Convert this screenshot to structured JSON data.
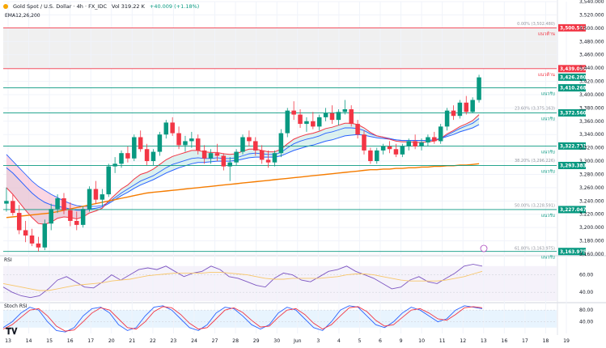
{
  "header": {
    "symbol": "Gold Spot / U.S. Dollar · 4h · FX_IDC",
    "volume": "Vol 319.22 K",
    "change": "+40.009 (+1.18%)",
    "ema_label": "EMA12,26,200"
  },
  "indicators": {
    "rsi_label": "RSI",
    "stoch_label": "Stoch RSI"
  },
  "colors": {
    "up": "#089981",
    "down": "#f23645",
    "ema12": "#f23645",
    "ema26": "#2962ff",
    "ema200": "#f57c00",
    "resistance": "#f23645",
    "support": "#089981"
  },
  "chart_data": [
    {
      "type": "candlestick",
      "title": "Gold Spot / U.S. Dollar · 4h · FX_IDC",
      "ylim": [
        3160,
        3540
      ],
      "y_ticks": [
        3160,
        3180,
        3200,
        3220,
        3240,
        3260,
        3280,
        3300,
        3320,
        3340,
        3360,
        3380,
        3400,
        3420,
        3440,
        3460,
        3480,
        3500,
        3520,
        3540
      ],
      "x_ticks": [
        "13",
        "14",
        "15",
        "16",
        "17",
        "20",
        "21",
        "22",
        "23",
        "24",
        "27",
        "28",
        "29",
        "30",
        "Jun",
        "3",
        "4",
        "5",
        "6",
        "9",
        "10",
        "11",
        "12",
        "13",
        "16",
        "17",
        "18",
        "19"
      ],
      "last_price": 3426.28,
      "candles_ohlc": [
        [
          3236,
          3260,
          3224,
          3240
        ],
        [
          3240,
          3250,
          3218,
          3222
        ],
        [
          3222,
          3234,
          3190,
          3196
        ],
        [
          3196,
          3210,
          3178,
          3188
        ],
        [
          3188,
          3198,
          3172,
          3176
        ],
        [
          3176,
          3186,
          3164,
          3170
        ],
        [
          3170,
          3212,
          3166,
          3206
        ],
        [
          3206,
          3236,
          3196,
          3228
        ],
        [
          3228,
          3250,
          3222,
          3244
        ],
        [
          3244,
          3252,
          3220,
          3226
        ],
        [
          3226,
          3238,
          3202,
          3210
        ],
        [
          3210,
          3224,
          3196,
          3204
        ],
        [
          3204,
          3232,
          3200,
          3228
        ],
        [
          3228,
          3262,
          3224,
          3258
        ],
        [
          3258,
          3270,
          3236,
          3242
        ],
        [
          3242,
          3258,
          3232,
          3250
        ],
        [
          3250,
          3296,
          3246,
          3292
        ],
        [
          3292,
          3306,
          3282,
          3296
        ],
        [
          3296,
          3316,
          3290,
          3312
        ],
        [
          3312,
          3322,
          3298,
          3304
        ],
        [
          3304,
          3340,
          3300,
          3336
        ],
        [
          3336,
          3346,
          3314,
          3318
        ],
        [
          3318,
          3326,
          3294,
          3300
        ],
        [
          3300,
          3318,
          3294,
          3314
        ],
        [
          3314,
          3344,
          3308,
          3340
        ],
        [
          3340,
          3362,
          3334,
          3358
        ],
        [
          3358,
          3366,
          3338,
          3342
        ],
        [
          3342,
          3352,
          3318,
          3324
        ],
        [
          3324,
          3338,
          3314,
          3330
        ],
        [
          3330,
          3344,
          3320,
          3334
        ],
        [
          3334,
          3340,
          3310,
          3316
        ],
        [
          3316,
          3324,
          3296,
          3304
        ],
        [
          3304,
          3318,
          3296,
          3312
        ],
        [
          3312,
          3326,
          3300,
          3308
        ],
        [
          3308,
          3312,
          3286,
          3292
        ],
        [
          3292,
          3306,
          3270,
          3298
        ],
        [
          3298,
          3318,
          3294,
          3314
        ],
        [
          3314,
          3340,
          3310,
          3336
        ],
        [
          3336,
          3346,
          3322,
          3330
        ],
        [
          3330,
          3336,
          3308,
          3316
        ],
        [
          3316,
          3324,
          3296,
          3302
        ],
        [
          3302,
          3316,
          3290,
          3298
        ],
        [
          3298,
          3316,
          3292,
          3312
        ],
        [
          3312,
          3348,
          3306,
          3342
        ],
        [
          3342,
          3380,
          3336,
          3376
        ],
        [
          3376,
          3390,
          3362,
          3370
        ],
        [
          3370,
          3378,
          3350,
          3356
        ],
        [
          3356,
          3366,
          3344,
          3360
        ],
        [
          3360,
          3374,
          3348,
          3352
        ],
        [
          3352,
          3370,
          3346,
          3366
        ],
        [
          3366,
          3380,
          3360,
          3372
        ],
        [
          3372,
          3384,
          3356,
          3362
        ],
        [
          3362,
          3378,
          3354,
          3374
        ],
        [
          3374,
          3392,
          3370,
          3378
        ],
        [
          3378,
          3384,
          3352,
          3356
        ],
        [
          3356,
          3362,
          3334,
          3340
        ],
        [
          3340,
          3346,
          3310,
          3316
        ],
        [
          3316,
          3320,
          3296,
          3300
        ],
        [
          3300,
          3320,
          3296,
          3316
        ],
        [
          3316,
          3326,
          3310,
          3322
        ],
        [
          3322,
          3330,
          3312,
          3318
        ],
        [
          3318,
          3326,
          3306,
          3310
        ],
        [
          3310,
          3326,
          3306,
          3322
        ],
        [
          3322,
          3334,
          3316,
          3330
        ],
        [
          3330,
          3340,
          3318,
          3322
        ],
        [
          3322,
          3334,
          3316,
          3328
        ],
        [
          3328,
          3340,
          3322,
          3336
        ],
        [
          3336,
          3344,
          3326,
          3330
        ],
        [
          3330,
          3356,
          3326,
          3352
        ],
        [
          3352,
          3380,
          3346,
          3376
        ],
        [
          3376,
          3384,
          3362,
          3368
        ],
        [
          3368,
          3392,
          3364,
          3388
        ],
        [
          3388,
          3398,
          3370,
          3374
        ],
        [
          3374,
          3396,
          3372,
          3392
        ],
        [
          3392,
          3430,
          3388,
          3426
        ]
      ],
      "ema12_points": [
        3260,
        3250,
        3238,
        3226,
        3215,
        3206,
        3205,
        3208,
        3214,
        3216,
        3215,
        3213,
        3216,
        3222,
        3225,
        3229,
        3240,
        3249,
        3258,
        3264,
        3273,
        3280,
        3283,
        3288,
        3295,
        3302,
        3307,
        3310,
        3313,
        3316,
        3316,
        3314,
        3313,
        3313,
        3311,
        3310,
        3311,
        3315,
        3318,
        3318,
        3316,
        3314,
        3314,
        3318,
        3326,
        3333,
        3337,
        3340,
        3342,
        3345,
        3349,
        3351,
        3354,
        3357,
        3357,
        3355,
        3350,
        3343,
        3338,
        3336,
        3333,
        3330,
        3329,
        3329,
        3328,
        3328,
        3329,
        3330,
        3334,
        3341,
        3346,
        3352,
        3356,
        3361,
        3370
      ],
      "ema26_points": [
        3290,
        3282,
        3272,
        3262,
        3252,
        3244,
        3238,
        3234,
        3232,
        3230,
        3228,
        3226,
        3226,
        3228,
        3229,
        3231,
        3236,
        3242,
        3248,
        3253,
        3259,
        3264,
        3268,
        3272,
        3277,
        3282,
        3286,
        3290,
        3293,
        3296,
        3298,
        3298,
        3299,
        3300,
        3300,
        3300,
        3301,
        3303,
        3305,
        3306,
        3306,
        3306,
        3306,
        3308,
        3312,
        3316,
        3319,
        3322,
        3324,
        3327,
        3330,
        3332,
        3335,
        3338,
        3339,
        3340,
        3339,
        3337,
        3335,
        3334,
        3333,
        3332,
        3331,
        3331,
        3331,
        3331,
        3331,
        3332,
        3334,
        3337,
        3340,
        3344,
        3347,
        3350,
        3355
      ],
      "ema200_points": [
        3215,
        3216,
        3217,
        3218,
        3219,
        3220,
        3221,
        3222,
        3224,
        3226,
        3228,
        3230,
        3232,
        3234,
        3236,
        3238,
        3240,
        3242,
        3244,
        3246,
        3248,
        3250,
        3252,
        3253,
        3254,
        3255,
        3256,
        3257,
        3258,
        3259,
        3260,
        3261,
        3262,
        3263,
        3264,
        3265,
        3266,
        3267,
        3268,
        3269,
        3270,
        3271,
        3272,
        3273,
        3274,
        3275,
        3276,
        3277,
        3278,
        3279,
        3280,
        3281,
        3282,
        3283,
        3284,
        3285,
        3286,
        3287,
        3287,
        3288,
        3288,
        3289,
        3289,
        3290,
        3290,
        3291,
        3291,
        3292,
        3292,
        3293,
        3293,
        3294,
        3294,
        3295,
        3296
      ],
      "band_top": [
        3310,
        3300,
        3290,
        3280,
        3270,
        3262,
        3256,
        3250,
        3245,
        3240,
        3236,
        3233,
        3232,
        3232,
        3232,
        3233,
        3238,
        3245,
        3252,
        3258,
        3264,
        3270,
        3274,
        3278,
        3284,
        3290,
        3295,
        3298,
        3301,
        3304,
        3305,
        3304,
        3304,
        3305,
        3304,
        3304,
        3305,
        3308,
        3311,
        3312,
        3311,
        3310,
        3310,
        3313,
        3320,
        3326,
        3330,
        3333,
        3335,
        3338,
        3342,
        3344,
        3347,
        3350,
        3350,
        3349,
        3346,
        3341,
        3338,
        3336,
        3334,
        3332,
        3331,
        3331,
        3331,
        3331,
        3331,
        3332,
        3334,
        3339,
        3344,
        3349,
        3353,
        3357,
        3364
      ],
      "levels": [
        {
          "label": "แนวต้าน",
          "value": 3500.551,
          "value_text": "3,500.551",
          "type": "resistance",
          "fib": "0.00% (3,502.480)",
          "fib_value": 3502.48
        },
        {
          "label": "แนวต้าน",
          "value": 3439.099,
          "value_text": "3,439.099",
          "type": "resistance"
        },
        {
          "label": "แนวรับ",
          "value": 3410.268,
          "value_text": "3,410.268",
          "type": "support"
        },
        {
          "label": "แนวรับ",
          "value": 3372.56,
          "value_text": "3,372.560",
          "type": "support",
          "fib": "23.60% (3,375.163)",
          "fib_value": 3375.163
        },
        {
          "label": "แนวรับ",
          "value": 3322.731,
          "value_text": "3,322.731",
          "type": "support"
        },
        {
          "label": "แนวรับ",
          "value": 3293.383,
          "value_text": "3,293.383",
          "type": "support",
          "fib": "38.20% (3,296.226)",
          "fib_value": 3296.226
        },
        {
          "label": "แนวรับ",
          "value": 3227.047,
          "value_text": "3,227.047",
          "type": "support",
          "fib": "50.00% (3,228.591)",
          "fib_value": 3228.591
        },
        {
          "label": "แนวรับ",
          "value": 3163.975,
          "value_text": "3,163.975",
          "type": "support",
          "fib": "61.80% (3,163.975)",
          "fib_value": 3163.975
        }
      ]
    },
    {
      "type": "line",
      "title": "RSI",
      "ylim": [
        30,
        80
      ],
      "y_ticks": [
        40,
        60
      ],
      "series": [
        {
          "color": "#7e57c2",
          "values": [
            46,
            40,
            36,
            34,
            36,
            44,
            54,
            58,
            52,
            46,
            45,
            52,
            60,
            54,
            60,
            66,
            68,
            66,
            70,
            64,
            58,
            62,
            64,
            70,
            66,
            58,
            56,
            52,
            48,
            46,
            56,
            62,
            60,
            54,
            52,
            58,
            64,
            66,
            70,
            64,
            60,
            56,
            50,
            44,
            46,
            54,
            58,
            52,
            50,
            56,
            62,
            70,
            72,
            70
          ]
        },
        {
          "color": "#f7c66a",
          "values": [
            50,
            48,
            46,
            44,
            42,
            42,
            44,
            46,
            48,
            49,
            50,
            51,
            53,
            54,
            55,
            57,
            59,
            60,
            61,
            62,
            62,
            62,
            62,
            63,
            63,
            62,
            61,
            60,
            58,
            56,
            55,
            55,
            56,
            56,
            56,
            56,
            57,
            58,
            60,
            61,
            61,
            60,
            58,
            56,
            54,
            53,
            53,
            53,
            53,
            54,
            56,
            58,
            61,
            64
          ]
        }
      ]
    },
    {
      "type": "line",
      "title": "Stoch RSI",
      "ylim": [
        0,
        100
      ],
      "y_ticks": [
        40,
        80
      ],
      "series": [
        {
          "color": "#2962ff",
          "values": [
            20,
            40,
            70,
            90,
            80,
            40,
            10,
            5,
            20,
            60,
            85,
            90,
            70,
            30,
            10,
            20,
            60,
            90,
            95,
            80,
            50,
            20,
            10,
            30,
            70,
            90,
            85,
            60,
            30,
            15,
            30,
            70,
            90,
            80,
            50,
            20,
            10,
            40,
            80,
            95,
            90,
            60,
            30,
            20,
            40,
            70,
            90,
            80,
            60,
            40,
            50,
            80,
            95,
            90,
            85
          ]
        },
        {
          "color": "#f23645",
          "values": [
            15,
            30,
            55,
            80,
            85,
            60,
            25,
            8,
            12,
            40,
            70,
            88,
            80,
            50,
            20,
            15,
            40,
            75,
            92,
            88,
            65,
            35,
            15,
            20,
            50,
            80,
            88,
            72,
            45,
            22,
            25,
            55,
            80,
            85,
            65,
            35,
            15,
            30,
            60,
            88,
            92,
            75,
            45,
            25,
            30,
            55,
            80,
            85,
            70,
            50,
            45,
            65,
            88,
            92,
            88
          ]
        }
      ]
    }
  ]
}
